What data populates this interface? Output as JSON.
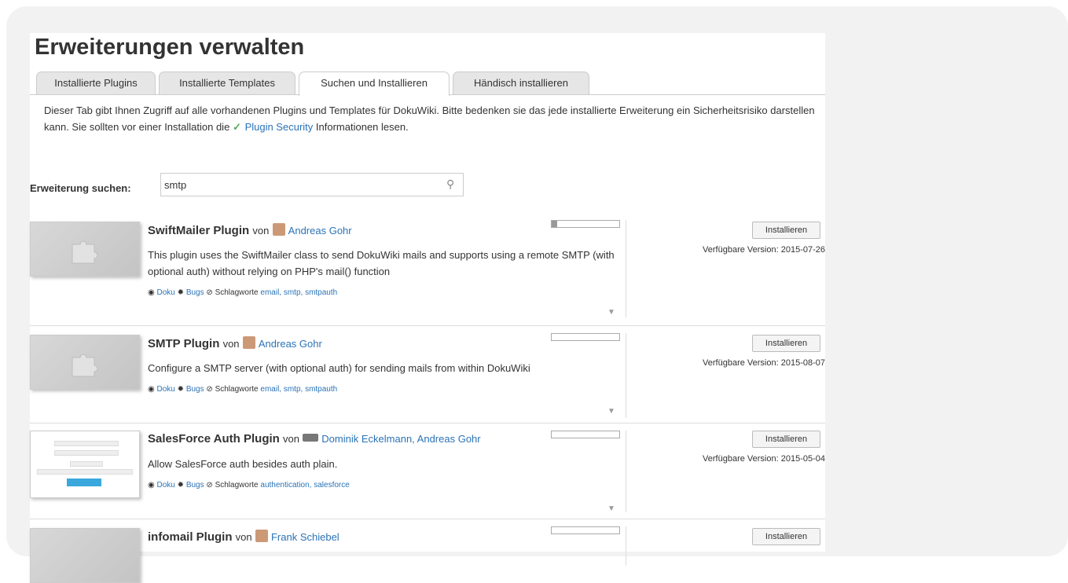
{
  "title": "Erweiterungen verwalten",
  "tabs": [
    {
      "label": "Installierte Plugins",
      "active": false
    },
    {
      "label": "Installierte Templates",
      "active": false
    },
    {
      "label": "Suchen und Installieren",
      "active": true
    },
    {
      "label": "Händisch installieren",
      "active": false
    }
  ],
  "intro": {
    "text_before": "Dieser Tab gibt Ihnen Zugriff auf alle vorhandenen Plugins und Templates für DokuWiki. Bitte bedenken sie das jede installierte Erweiterung ein Sicherheitsrisiko darstellen kann. Sie sollten vor einer Installation die",
    "link": "Plugin Security",
    "text_after": "Informationen lesen."
  },
  "search": {
    "label": "Erweiterung suchen:",
    "value": "smtp"
  },
  "common": {
    "von": "von",
    "doku": "Doku",
    "bugs": "Bugs",
    "tags_label": "Schlagworte",
    "install": "Installieren",
    "version_label": "Verfügbare Version:"
  },
  "extensions": [
    {
      "name": "SwiftMailer Plugin",
      "author": "Andreas Gohr",
      "desc": "This plugin uses the SwiftMailer class to send DokuWiki mails and supports using a remote SMTP (with optional auth) without relying on PHP's mail() function",
      "tags": "email, smtp, smtpauth",
      "version": "2015-07-26",
      "popularity": 0.08
    },
    {
      "name": "SMTP Plugin",
      "author": "Andreas Gohr",
      "desc": "Configure a SMTP server (with optional auth) for sending mails from within DokuWiki",
      "tags": "email, smtp, smtpauth",
      "version": "2015-08-07",
      "popularity": 0.0
    },
    {
      "name": "SalesForce Auth Plugin",
      "author": "Dominik Eckelmann, Andreas Gohr",
      "desc": "Allow SalesForce auth besides auth plain.",
      "tags": "authentication, salesforce",
      "version": "2015-05-04",
      "popularity": 0.0
    },
    {
      "name": "infomail Plugin",
      "author": "Frank Schiebel",
      "popularity": 0.0
    }
  ],
  "icons": {
    "search": "search-icon",
    "doku": "globe-icon",
    "bugs": "bug-icon",
    "tags": "tag-icon",
    "security": "security-icon",
    "more": "chevron-down-icon"
  }
}
